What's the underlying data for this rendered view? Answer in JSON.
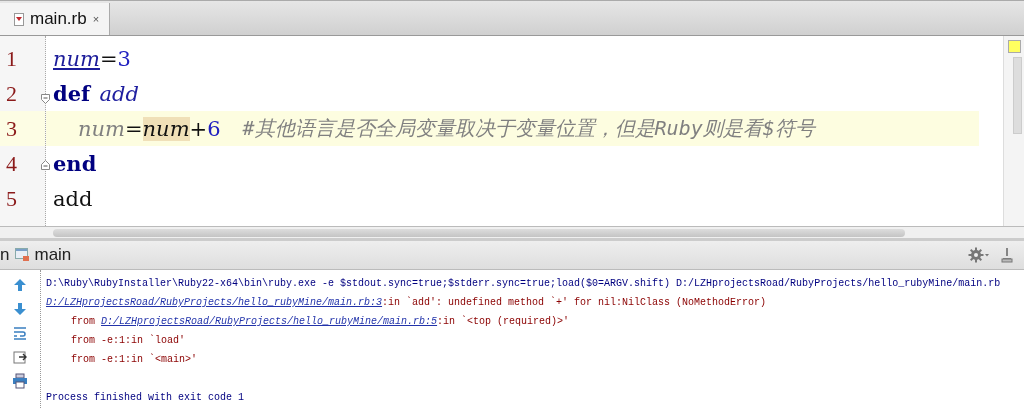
{
  "tabs": [
    {
      "label": "main.rb",
      "selected": true,
      "close": "×"
    }
  ],
  "editor": {
    "lines": [
      {
        "number": "1",
        "current": false,
        "indented": false,
        "tokens": [
          {
            "kind": "global-var",
            "text": "num"
          },
          {
            "kind": "op",
            "text": "="
          },
          {
            "kind": "number",
            "text": "3"
          }
        ]
      },
      {
        "number": "2",
        "current": false,
        "indented": false,
        "kind": "block-start",
        "tokens": [
          {
            "kind": "keyword",
            "text": "def"
          },
          {
            "kind": "method-name",
            "text": "add"
          }
        ]
      },
      {
        "number": "3",
        "current": true,
        "indented": true,
        "tokens": [
          {
            "kind": "unused-var",
            "text": "num"
          },
          {
            "kind": "op",
            "text": "="
          },
          {
            "kind": "highlighted-var",
            "text": "num"
          },
          {
            "kind": "op",
            "text": "+"
          },
          {
            "kind": "number",
            "text": "6"
          },
          {
            "kind": "comment",
            "text": "#其他语言是否全局变量取决于变量位置，但是Ruby则是看$符号"
          }
        ]
      },
      {
        "number": "4",
        "current": false,
        "indented": false,
        "kind": "block-end",
        "tokens": [
          {
            "kind": "keyword",
            "text": "end"
          }
        ]
      },
      {
        "number": "5",
        "current": false,
        "indented": false,
        "tokens": [
          {
            "kind": "call",
            "text": "add"
          }
        ]
      }
    ]
  },
  "run_panel": {
    "title_cut": "n",
    "config": "main",
    "console": [
      {
        "kind": "command",
        "segments": [
          {
            "kind": "text",
            "text": "D:\\Ruby\\RubyInstaller\\Ruby22-x64\\bin\\ruby.exe -e $stdout.sync=true;$stderr.sync=true;load($0=ARGV.shift) D:/LZHprojectsRoad/RubyProjects/hello_rubyMine/main.rb"
          }
        ]
      },
      {
        "kind": "error",
        "segments": [
          {
            "kind": "link",
            "text": "D:/LZHprojectsRoad/RubyProjects/hello_rubyMine/main.rb:3"
          },
          {
            "kind": "text",
            "text": ":in `add': undefined method `+' for nil:NilClass (NoMethodError)"
          }
        ]
      },
      {
        "kind": "error",
        "segments": [
          {
            "kind": "text",
            "text": "from "
          },
          {
            "kind": "link",
            "text": "D:/LZHprojectsRoad/RubyProjects/hello_rubyMine/main.rb:5"
          },
          {
            "kind": "text",
            "text": ":in `<top (required)>'"
          }
        ],
        "indented": true
      },
      {
        "kind": "error",
        "segments": [
          {
            "kind": "text",
            "text": "from -e:1:in `load'"
          }
        ],
        "indented": true
      },
      {
        "kind": "error",
        "segments": [
          {
            "kind": "text",
            "text": "from -e:1:in `<main>'"
          }
        ],
        "indented": true
      },
      {
        "kind": "blank"
      },
      {
        "kind": "command",
        "segments": [
          {
            "kind": "text",
            "text": "Process finished with exit code 1"
          }
        ]
      }
    ]
  }
}
